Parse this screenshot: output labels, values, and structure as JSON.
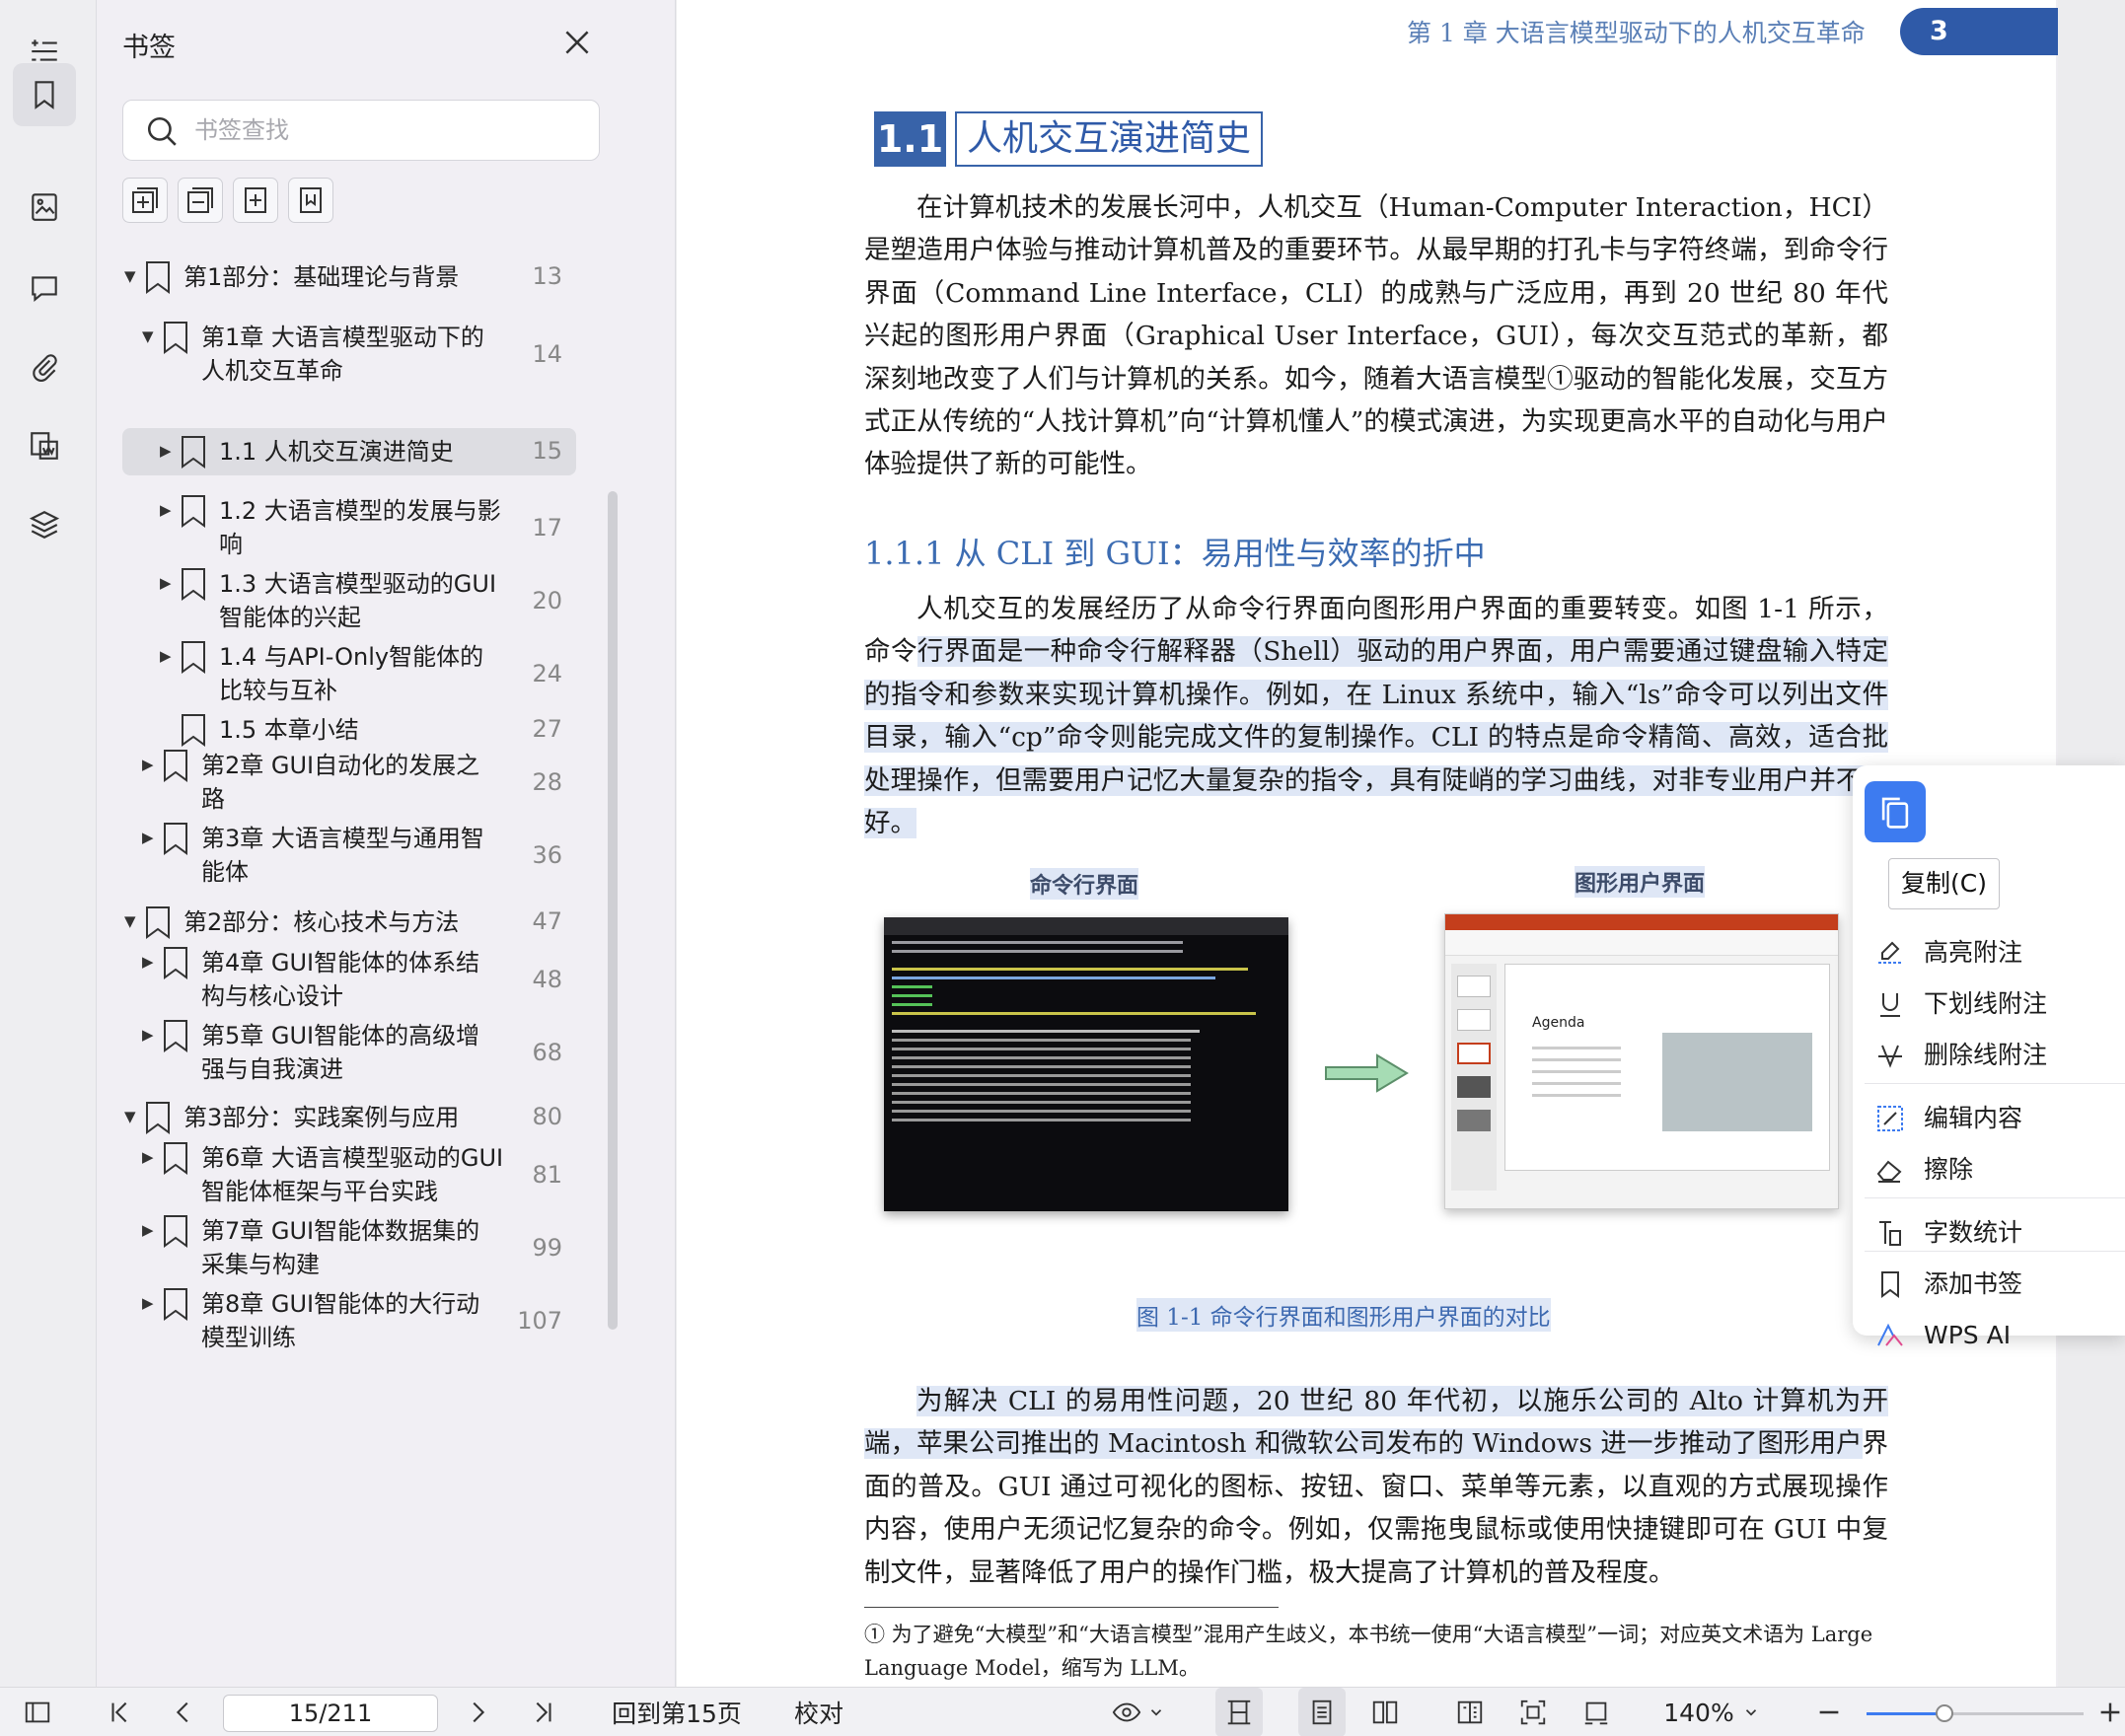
{
  "panel": {
    "title": "书签",
    "search_placeholder": "书签查找"
  },
  "bookmarks": [
    {
      "level": 0,
      "expanded": true,
      "label": "第1部分：基础理论与背景",
      "page": "13"
    },
    {
      "level": 1,
      "expanded": true,
      "label": "第1章  大语言模型驱动下的",
      "label2": "人机交互革命",
      "page": "14"
    },
    {
      "level": 2,
      "expanded": false,
      "selected": true,
      "label": "1.1 人机交互演进简史",
      "page": "15"
    },
    {
      "level": 2,
      "expanded": false,
      "label": "1.2 大语言模型的发展与影",
      "label2": "响",
      "page": "17"
    },
    {
      "level": 2,
      "expanded": false,
      "label": "1.3 大语言模型驱动的GUI",
      "label2": "智能体的兴起",
      "page": "20"
    },
    {
      "level": 2,
      "expanded": false,
      "label": "1.4 与API-Only智能体的",
      "label2": "比较与互补",
      "page": "24"
    },
    {
      "level": 2,
      "leaf": true,
      "label": "1.5 本章小结",
      "page": "27"
    },
    {
      "level": 1,
      "expanded": false,
      "label": "第2章  GUI自动化的发展之",
      "label2": "路",
      "page": "28"
    },
    {
      "level": 1,
      "expanded": false,
      "label": "第3章  大语言模型与通用智",
      "label2": "能体",
      "page": "36"
    },
    {
      "level": 0,
      "expanded": true,
      "label": "第2部分：核心技术与方法",
      "page": "47"
    },
    {
      "level": 1,
      "expanded": false,
      "label": "第4章  GUI智能体的体系结",
      "label2": "构与核心设计",
      "page": "48"
    },
    {
      "level": 1,
      "expanded": false,
      "label": "第5章  GUI智能体的高级增",
      "label2": "强与自我演进",
      "page": "68"
    },
    {
      "level": 0,
      "expanded": true,
      "label": "第3部分：实践案例与应用",
      "page": "80"
    },
    {
      "level": 1,
      "expanded": false,
      "label": "第6章  大语言模型驱动的GUI",
      "label2": "智能体框架与平台实践",
      "page": "81"
    },
    {
      "level": 1,
      "expanded": false,
      "label": "第7章  GUI智能体数据集的",
      "label2": "采集与构建",
      "page": "99"
    },
    {
      "level": 1,
      "expanded": false,
      "label": "第8章  GUI智能体的大行动",
      "label2": "模型训练",
      "page": "107"
    }
  ],
  "document": {
    "running_head": "第 1 章   大语言模型驱动下的人机交互革命",
    "page_number": "3",
    "section_number": "1.1",
    "section_title": "人机交互演进简史",
    "para1": "在计算机技术的发展长河中，人机交互（Human-Computer Interaction，HCI）是塑造用户体验与推动计算机普及的重要环节。从最早期的打孔卡与字符终端，到命令行界面（Command Line Interface，CLI）的成熟与广泛应用，再到 20 世纪 80 年代兴起的图形用户界面（Graphical User Interface，GUI），每次交互范式的革新，都深刻地改变了人们与计算机的关系。如今，随着大语言模型①驱动的智能化发展，交互方式正从传统的“人找计算机”向“计算机懂人”的模式演进，为实现更高水平的自动化与用户体验提供了新的可能性。",
    "subsection_title": "1.1.1  从 CLI 到 GUI：易用性与效率的折中",
    "para2_plain": "人机交互的发展经历了从命令行界面向图形用户界面的重要转变。如图 1-1 所示，命令",
    "para2_highlight": "行界面是一种命令行解释器（Shell）驱动的用户界面，用户需要通过键盘输入特定的指令和参数来实现计算机操作。例如，在 Linux 系统中，输入“ls”命令可以列出文件目录，输入“cp”命令则能完成文件的复制操作。CLI 的特点是命令精简、高效，适合批处理操作，但需要用户记忆大量复杂的指令，具有陡峭的学习曲线，对非专业用户并不友好。",
    "fig_label_left": "命令行界面",
    "fig_label_right": "图形用户界面",
    "ppt_title": "Agenda",
    "fig_caption": "图 1-1    命令行界面和图形用户界面的对比",
    "para3_highlight": "为解决 CLI 的易用性问题，20 世纪 80 年代初，以施乐公司的 Alto 计算机为开端，苹果公司推出的 Macintosh 和微软公司发布的 Windows 进一步推动了图形用户",
    "para3_plain": "界面的普及。GUI 通过可视化的图标、按钮、窗口、菜单等元素，以直观的方式展现操作内容，使用户无须记忆复杂的命令。例如，仅需拖曳鼠标或使用快捷键即可在 GUI 中复制文件，显著降低了用户的操作门槛，极大提高了计算机的普及程度。",
    "footnote": "① 为了避免“大模型”和“大语言模型”混用产生歧义，本书统一使用“大语言模型”一词；对应英文术语为 Large Language Model，缩写为 LLM。"
  },
  "context_menu": {
    "copy_tooltip": "复制(C)",
    "items": [
      {
        "label": "高亮附注",
        "icon": "highlight-note-icon"
      },
      {
        "label": "下划线附注",
        "icon": "underline-note-icon"
      },
      {
        "label": "删除线附注",
        "icon": "strikethrough-note-icon"
      },
      {
        "label": "编辑内容",
        "icon": "edit-content-icon"
      },
      {
        "label": "擦除",
        "icon": "eraser-icon"
      },
      {
        "label": "字数统计",
        "icon": "word-count-icon"
      },
      {
        "label": "添加书签",
        "icon": "add-bookmark-icon"
      },
      {
        "label": "WPS AI",
        "icon": "wps-ai-icon"
      }
    ]
  },
  "statusbar": {
    "page_value": "15/211",
    "back_to_page": "回到第15页",
    "proofread": "校对",
    "zoom": "140%",
    "zoom_level": 0.36
  },
  "colors": {
    "accent": "#3d7bf0",
    "heading_blue": "#3863a9",
    "selection": "#dfe7f6"
  }
}
